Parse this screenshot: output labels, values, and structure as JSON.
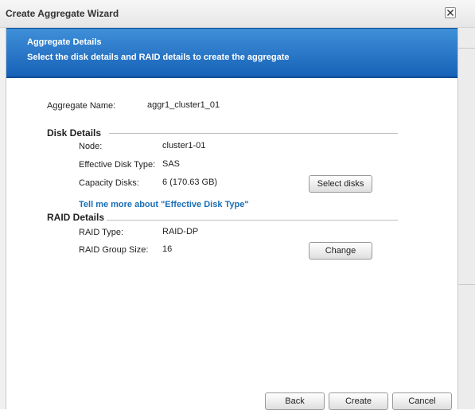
{
  "window": {
    "title": "Create Aggregate Wizard"
  },
  "banner": {
    "title": "Aggregate Details",
    "subtitle": "Select the disk details and RAID details to create the aggregate"
  },
  "aggregate": {
    "name_label": "Aggregate Name:",
    "name_value": "aggr1_cluster1_01"
  },
  "disk_details": {
    "heading": "Disk Details",
    "node_label": "Node:",
    "node_value": "cluster1-01",
    "disk_type_label": "Effective Disk Type:",
    "disk_type_value": "SAS",
    "capacity_label": "Capacity Disks:",
    "capacity_value": "6 (170.63 GB)",
    "select_button": "Select disks",
    "help_link": "Tell me more about \"Effective Disk Type\""
  },
  "raid_details": {
    "heading": "RAID Details",
    "type_label": "RAID Type:",
    "type_value": "RAID-DP",
    "group_label": "RAID Group Size:",
    "group_value": "16",
    "change_button": "Change"
  },
  "footer": {
    "back": "Back",
    "create": "Create",
    "cancel": "Cancel"
  },
  "colors": {
    "banner": "#1f6dc2",
    "link": "#1a6fb7"
  }
}
